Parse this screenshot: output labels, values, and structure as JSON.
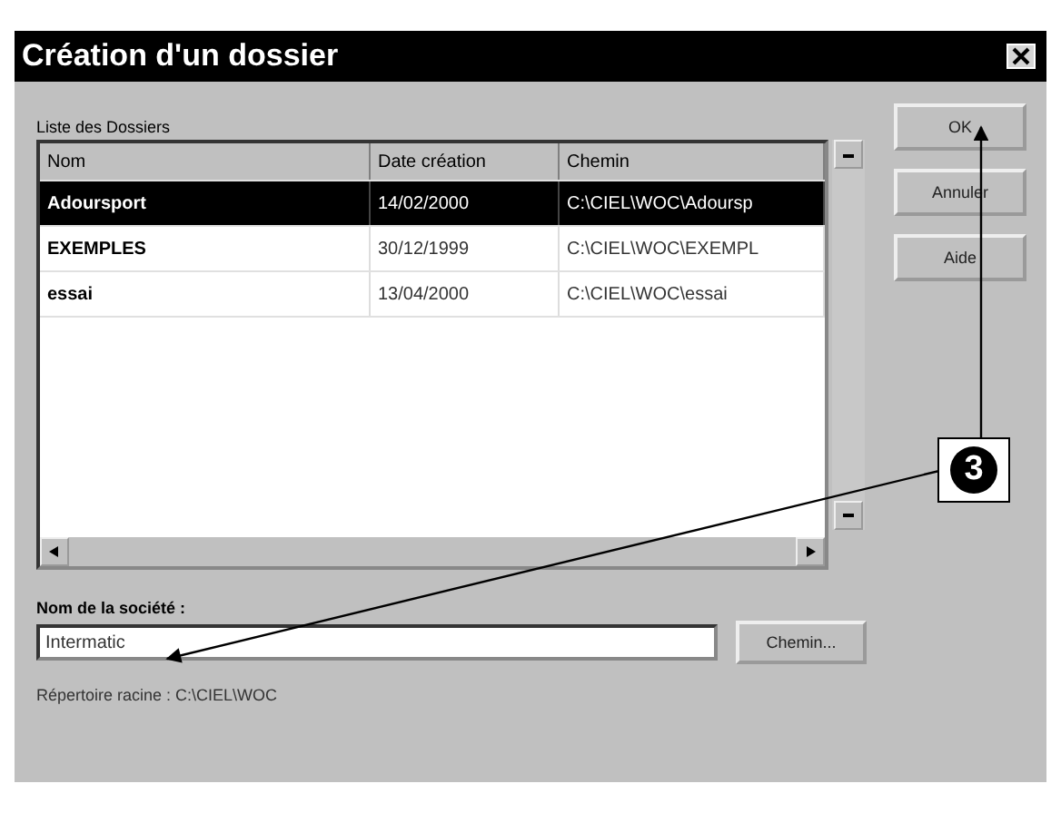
{
  "window": {
    "title": "Création d'un dossier"
  },
  "list": {
    "label": "Liste des Dossiers",
    "columns": [
      "Nom",
      "Date création",
      "Chemin"
    ],
    "rows": [
      {
        "cells": [
          "Adoursport",
          "14/02/2000",
          "C:\\CIEL\\WOC\\Adoursp"
        ],
        "selected": true
      },
      {
        "cells": [
          "EXEMPLES",
          "30/12/1999",
          "C:\\CIEL\\WOC\\EXEMPL"
        ],
        "selected": false
      },
      {
        "cells": [
          "essai",
          "13/04/2000",
          "C:\\CIEL\\WOC\\essai"
        ],
        "selected": false
      }
    ]
  },
  "company_field": {
    "label": "Nom de la société :",
    "value": "Intermatic"
  },
  "browse_button": "Chemin...",
  "root_directory": "Répertoire racine : C:\\CIEL\\WOC",
  "buttons": [
    "OK",
    "Annuler",
    "Aide"
  ],
  "callout": {
    "label": "3"
  }
}
